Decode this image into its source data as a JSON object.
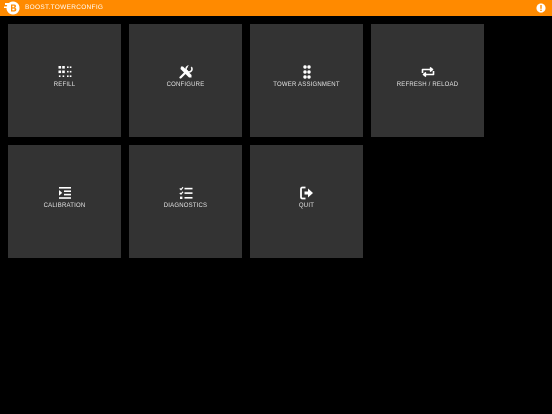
{
  "header": {
    "title": "BOOST.TOWERCONFIG",
    "logo_icon": "boost-logo-icon",
    "info_icon": "info-icon",
    "bar_color": "#ff8a00"
  },
  "tiles": [
    {
      "label": "REFILL",
      "icon": "dotted-grid-icon"
    },
    {
      "label": "CONFIGURE",
      "icon": "tools-icon"
    },
    {
      "label": "TOWER ASSIGNMENT",
      "icon": "dot-grid-icon"
    },
    {
      "label": "REFRESH / RELOAD",
      "icon": "refresh-icon"
    },
    {
      "label": "CALIBRATION",
      "icon": "indent-icon"
    },
    {
      "label": "DIAGNOSTICS",
      "icon": "checklist-icon"
    },
    {
      "label": "QUIT",
      "icon": "sign-out-icon"
    }
  ],
  "colors": {
    "tile_background": "#333333",
    "page_background": "#000000",
    "text": "#e6e6e6"
  }
}
